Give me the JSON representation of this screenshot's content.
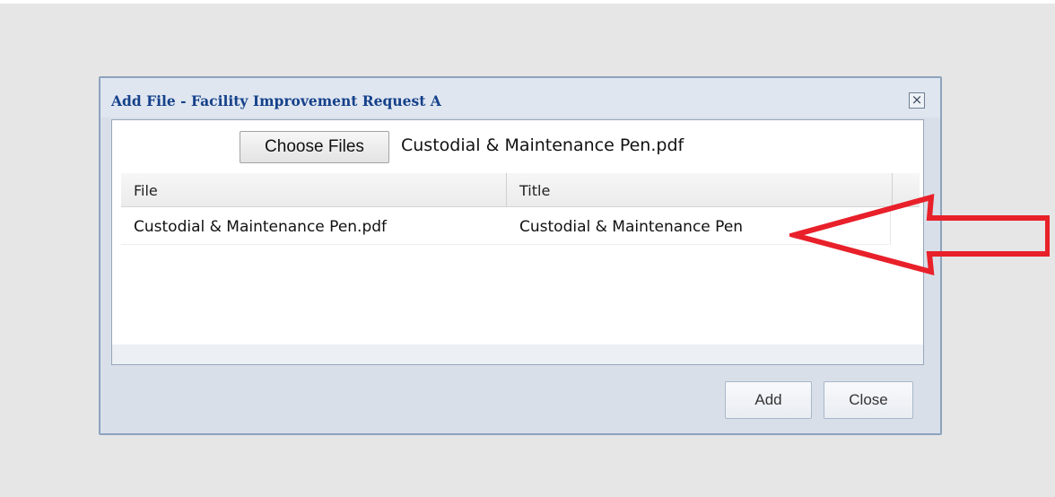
{
  "dialog": {
    "title": "Add File - Facility Improvement Request A",
    "close_glyph": "×",
    "close_icon": "close-icon"
  },
  "upload": {
    "choose_label": "Choose Files",
    "chosen_file": "Custodial & Maintenance Pen.pdf"
  },
  "grid": {
    "columns": [
      "File",
      "Title"
    ],
    "rows": [
      {
        "file": "Custodial & Maintenance Pen.pdf",
        "title": "Custodial & Maintenance Pen"
      }
    ]
  },
  "buttons": {
    "add_label": "Add",
    "close_label": "Close"
  },
  "annotation": {
    "icon": "red-arrow-icon",
    "color": "#e8202a"
  }
}
